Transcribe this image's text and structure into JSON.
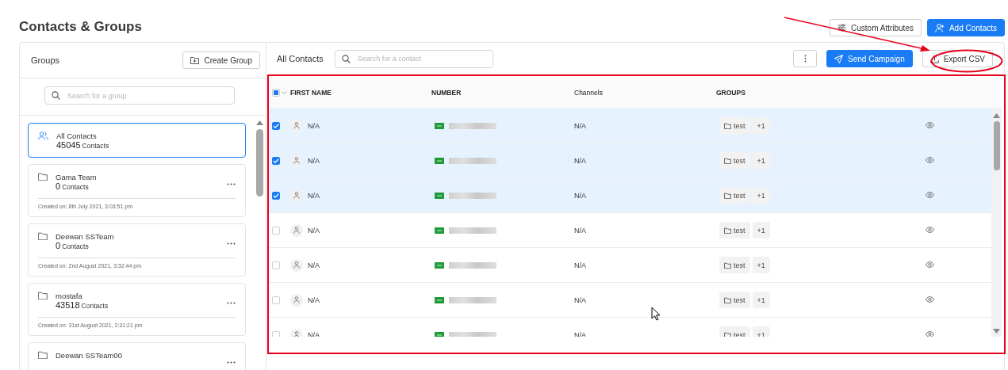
{
  "page_title": "Contacts & Groups",
  "top_actions": [
    {
      "kind": "outline",
      "label": "Custom Attributes"
    },
    {
      "kind": "primary",
      "label": "Add Contacts"
    }
  ],
  "groups_panel": {
    "title": "Groups",
    "create_button": "Create Group",
    "search": {
      "placeholder": "Search for a group"
    },
    "items": [
      {
        "kind": "all",
        "name": "All Contacts",
        "count": "45045",
        "count_label": "Contacts",
        "selected": true
      },
      {
        "kind": "group",
        "name": "Gama Team",
        "count": "0",
        "count_label": "Contacts",
        "created": "Created on: 8th July 2021, 3:03:51 pm",
        "selected": false
      },
      {
        "kind": "group",
        "name": "Deewan SSTeam",
        "count": "0",
        "count_label": "Contacts",
        "created": "Created on: 2nd August 2021, 3:32:44 pm",
        "selected": false
      },
      {
        "kind": "group",
        "name": "mostafa",
        "count": "43518",
        "count_label": "Contacts",
        "created": "Created on: 31st August 2021, 2:31:21 pm",
        "selected": false
      },
      {
        "kind": "group",
        "name": "Deewan SSTeam00",
        "selected": false
      }
    ]
  },
  "contacts_panel": {
    "title": "All Contacts",
    "search": {
      "placeholder": "Search for a contact"
    },
    "actions": [
      {
        "kind": "more"
      },
      {
        "kind": "primary",
        "label": "Send Campaign"
      },
      {
        "kind": "outline",
        "label": "Export CSV"
      }
    ],
    "table": {
      "header_checkbox": {
        "indeterminate": true
      },
      "columns": [
        "FIRST NAME",
        "NUMBER",
        "Channels",
        "GROUPS"
      ],
      "rows": [
        {
          "selected": true,
          "first_name": "N/A",
          "channels": "N/A",
          "group": "test",
          "more_groups": "+1"
        },
        {
          "selected": true,
          "first_name": "N/A",
          "channels": "N/A",
          "group": "test",
          "more_groups": "+1"
        },
        {
          "selected": true,
          "first_name": "N/A",
          "channels": "N/A",
          "group": "test",
          "more_groups": "+1"
        },
        {
          "selected": false,
          "first_name": "N/A",
          "channels": "N/A",
          "group": "test",
          "more_groups": "+1"
        },
        {
          "selected": false,
          "first_name": "N/A",
          "channels": "N/A",
          "group": "test",
          "more_groups": "+1"
        },
        {
          "selected": false,
          "first_name": "N/A",
          "channels": "N/A",
          "group": "test",
          "more_groups": "+1"
        },
        {
          "selected": false,
          "first_name": "N/A",
          "channels": "N/A",
          "group": "test",
          "more_groups": "+1"
        }
      ]
    }
  },
  "annotations": [
    {
      "kind": "arrow"
    },
    {
      "kind": "ellipse"
    },
    {
      "kind": "rectangle"
    }
  ]
}
